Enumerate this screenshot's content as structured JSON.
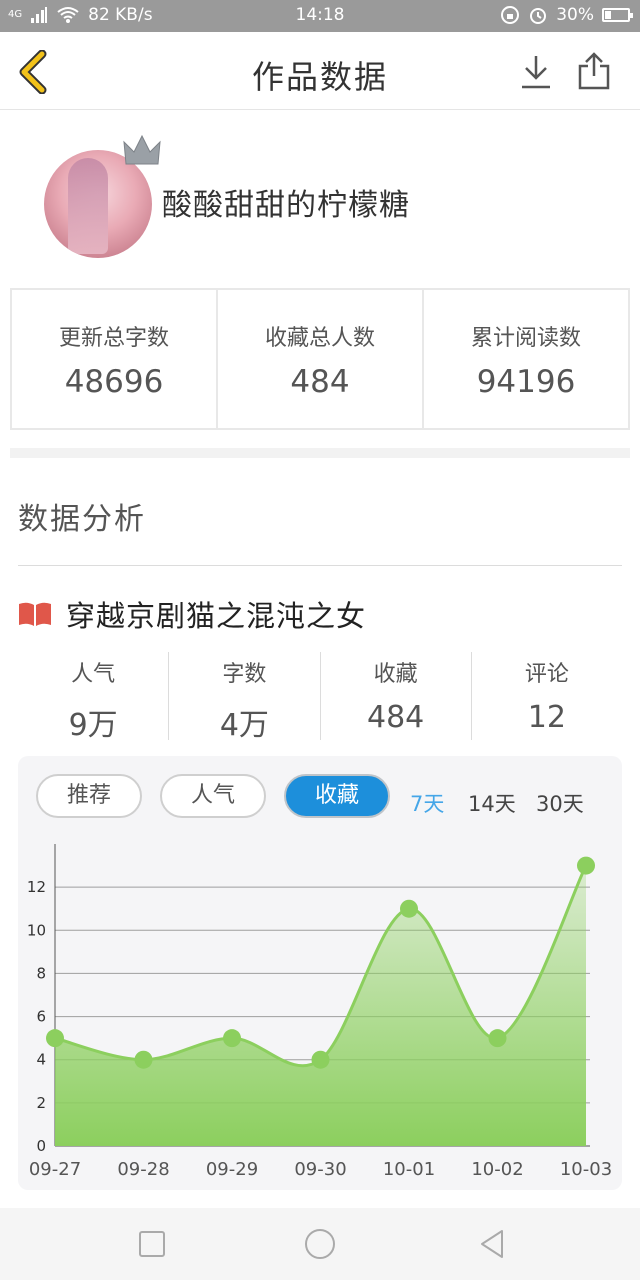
{
  "status_bar": {
    "signal": "4G",
    "speed": "82 KB/s",
    "time": "14:18",
    "battery": "30%"
  },
  "header": {
    "title": "作品数据",
    "back_icon": "chevron-left-icon",
    "download_icon": "download-icon",
    "share_icon": "share-icon",
    "accent": "#f2c21a"
  },
  "profile": {
    "username": "酸酸甜甜的柠檬糖"
  },
  "stats": [
    {
      "label": "更新总字数",
      "value": "48696"
    },
    {
      "label": "收藏总人数",
      "value": "484"
    },
    {
      "label": "累计阅读数",
      "value": "94196"
    }
  ],
  "analysis": {
    "title": "数据分析",
    "book_title": "穿越京剧猫之混沌之女",
    "book_icon_color": "#e0574a",
    "metrics": [
      {
        "label": "人气",
        "value": "9万"
      },
      {
        "label": "字数",
        "value": "4万"
      },
      {
        "label": "收藏",
        "value": "484"
      },
      {
        "label": "评论",
        "value": "12"
      }
    ],
    "tabs": [
      "推荐",
      "人气",
      "收藏"
    ],
    "active_tab": "收藏",
    "ranges": [
      "7天",
      "14天",
      "30天"
    ],
    "active_range": "7天",
    "active_color": "#1d8fdb"
  },
  "chart_data": {
    "type": "area",
    "categories": [
      "09-27",
      "09-28",
      "09-29",
      "09-30",
      "10-01",
      "10-02",
      "10-03"
    ],
    "values": [
      5,
      4,
      5,
      4,
      11,
      5,
      13
    ],
    "yticks": [
      0,
      2,
      4,
      6,
      8,
      10,
      12
    ],
    "ylim": [
      0,
      14
    ],
    "grid": true,
    "color": "#8ccf5e"
  },
  "navbar": {
    "icons": [
      "square-icon",
      "circle-icon",
      "back-triangle-icon"
    ]
  }
}
